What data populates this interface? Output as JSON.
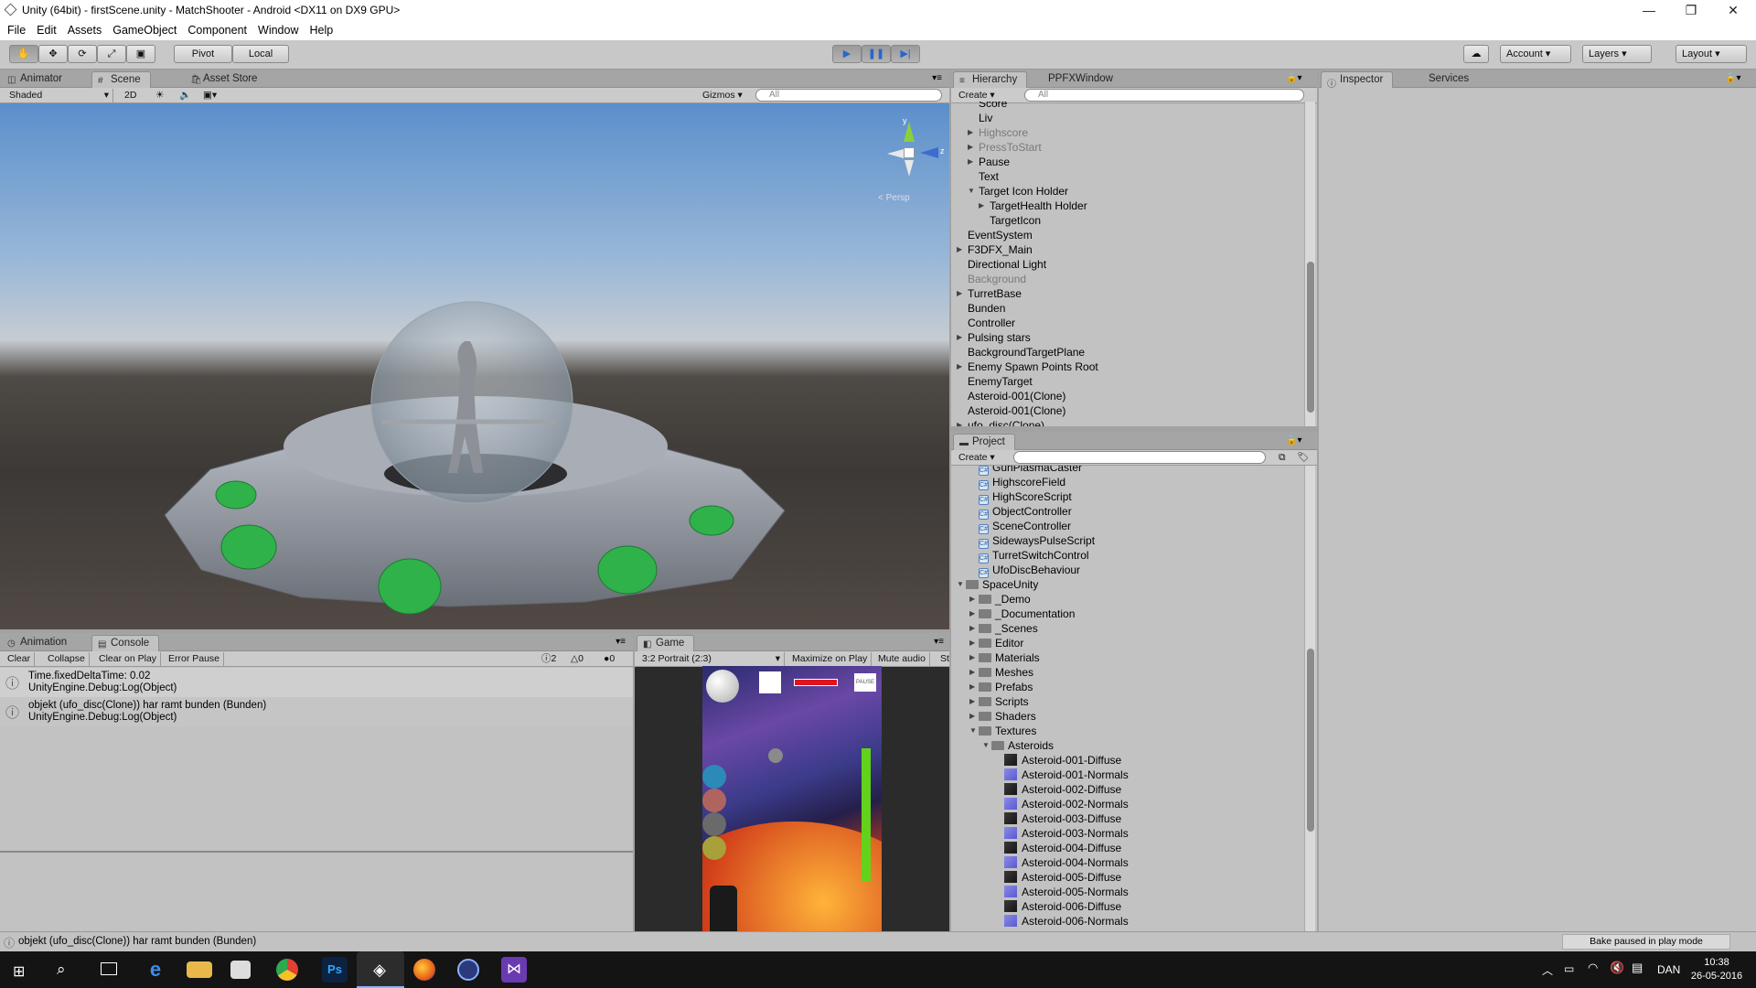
{
  "window": {
    "title": "Unity (64bit) - firstScene.unity - MatchShooter - Android <DX11 on DX9 GPU>",
    "minimize": "—",
    "maximize": "❐",
    "close": "✕"
  },
  "menu": [
    "File",
    "Edit",
    "Assets",
    "GameObject",
    "Component",
    "Window",
    "Help"
  ],
  "toolbar": {
    "pivot": "Pivot",
    "local": "Local",
    "account": "Account",
    "layers": "Layers",
    "layout": "Layout"
  },
  "scene_panel": {
    "tabs": [
      "Animator",
      "Scene",
      "Asset Store"
    ],
    "shading": "Shaded",
    "mode_2d": "2D",
    "gizmos": "Gizmos",
    "search_placeholder": "All",
    "persp": "< Persp",
    "axis_y": "y",
    "axis_z": "z"
  },
  "hierarchy": {
    "tabs": [
      "Hierarchy",
      "PPFXWindow"
    ],
    "create": "Create",
    "search_placeholder": "All",
    "items": [
      {
        "label": "Score",
        "indent": 2,
        "arrow": "",
        "grey": false
      },
      {
        "label": "Liv",
        "indent": 2,
        "arrow": "",
        "grey": false
      },
      {
        "label": "Highscore",
        "indent": 2,
        "arrow": "▶",
        "grey": true
      },
      {
        "label": "PressToStart",
        "indent": 2,
        "arrow": "▶",
        "grey": true
      },
      {
        "label": "Pause",
        "indent": 2,
        "arrow": "▶",
        "grey": false
      },
      {
        "label": "Text",
        "indent": 2,
        "arrow": "",
        "grey": false
      },
      {
        "label": "Target Icon Holder",
        "indent": 2,
        "arrow": "▼",
        "grey": false
      },
      {
        "label": "TargetHealth Holder",
        "indent": 3,
        "arrow": "▶",
        "grey": false
      },
      {
        "label": "TargetIcon",
        "indent": 3,
        "arrow": "",
        "grey": false
      },
      {
        "label": "EventSystem",
        "indent": 1,
        "arrow": "",
        "grey": false
      },
      {
        "label": "F3DFX_Main",
        "indent": 1,
        "arrow": "▶",
        "grey": false
      },
      {
        "label": "Directional Light",
        "indent": 1,
        "arrow": "",
        "grey": false
      },
      {
        "label": "Background",
        "indent": 1,
        "arrow": "",
        "grey": true
      },
      {
        "label": "TurretBase",
        "indent": 1,
        "arrow": "▶",
        "grey": false
      },
      {
        "label": "Bunden",
        "indent": 1,
        "arrow": "",
        "grey": false
      },
      {
        "label": "Controller",
        "indent": 1,
        "arrow": "",
        "grey": false
      },
      {
        "label": "Pulsing stars",
        "indent": 1,
        "arrow": "▶",
        "grey": false
      },
      {
        "label": "BackgroundTargetPlane",
        "indent": 1,
        "arrow": "",
        "grey": false
      },
      {
        "label": "Enemy Spawn Points Root",
        "indent": 1,
        "arrow": "▶",
        "grey": false
      },
      {
        "label": "EnemyTarget",
        "indent": 1,
        "arrow": "",
        "grey": false
      },
      {
        "label": "Asteroid-001(Clone)",
        "indent": 1,
        "arrow": "",
        "grey": false
      },
      {
        "label": "Asteroid-001(Clone)",
        "indent": 1,
        "arrow": "",
        "grey": false
      },
      {
        "label": "ufo_disc(Clone)",
        "indent": 1,
        "arrow": "▶",
        "grey": false
      }
    ]
  },
  "project": {
    "tab": "Project",
    "create": "Create",
    "scripts": [
      "GunPlasmaCaster",
      "HighscoreField",
      "HighScoreScript",
      "ObjectController",
      "SceneController",
      "SidewaysPulseScript",
      "TurretSwitchControl",
      "UfoDiscBehaviour"
    ],
    "folders_root": "SpaceUnity",
    "folders": [
      {
        "label": "_Demo",
        "arrow": "▶"
      },
      {
        "label": "_Documentation",
        "arrow": "▶"
      },
      {
        "label": "_Scenes",
        "arrow": "▶"
      },
      {
        "label": "Editor",
        "arrow": "▶"
      },
      {
        "label": "Materials",
        "arrow": "▶"
      },
      {
        "label": "Meshes",
        "arrow": "▶"
      },
      {
        "label": "Prefabs",
        "arrow": "▶"
      },
      {
        "label": "Scripts",
        "arrow": "▶"
      },
      {
        "label": "Shaders",
        "arrow": "▶"
      },
      {
        "label": "Textures",
        "arrow": "▼"
      }
    ],
    "subfolder": "Asteroids",
    "textures": [
      {
        "label": "Asteroid-001-Diffuse",
        "kind": "diffuse"
      },
      {
        "label": "Asteroid-001-Normals",
        "kind": "normals"
      },
      {
        "label": "Asteroid-002-Diffuse",
        "kind": "diffuse"
      },
      {
        "label": "Asteroid-002-Normals",
        "kind": "normals"
      },
      {
        "label": "Asteroid-003-Diffuse",
        "kind": "diffuse"
      },
      {
        "label": "Asteroid-003-Normals",
        "kind": "normals"
      },
      {
        "label": "Asteroid-004-Diffuse",
        "kind": "diffuse"
      },
      {
        "label": "Asteroid-004-Normals",
        "kind": "normals"
      },
      {
        "label": "Asteroid-005-Diffuse",
        "kind": "diffuse"
      },
      {
        "label": "Asteroid-005-Normals",
        "kind": "normals"
      },
      {
        "label": "Asteroid-006-Diffuse",
        "kind": "diffuse"
      },
      {
        "label": "Asteroid-006-Normals",
        "kind": "normals"
      }
    ]
  },
  "inspector": {
    "tabs": [
      "Inspector",
      "Services"
    ]
  },
  "console": {
    "tabs": [
      "Animation",
      "Console"
    ],
    "buttons": [
      "Clear",
      "Collapse",
      "Clear on Play",
      "Error Pause"
    ],
    "counts": {
      "log": "2",
      "warn": "0",
      "error": "0"
    },
    "entries": [
      {
        "line1": "Time.fixedDeltaTime: 0.02",
        "line2": "UnityEngine.Debug:Log(Object)"
      },
      {
        "line1": "objekt (ufo_disc(Clone)) har ramt bunden (Bunden)",
        "line2": "UnityEngine.Debug:Log(Object)"
      }
    ]
  },
  "game": {
    "tab": "Game",
    "aspect": "3:2 Portrait (2:3)",
    "maximize": "Maximize on Play",
    "mute": "Mute audio",
    "stats": "St",
    "pause_label": "PAUSE"
  },
  "statusbar": {
    "message": "objekt (ufo_disc(Clone)) har ramt bunden (Bunden)",
    "bake": "Bake paused in play mode"
  },
  "taskbar": {
    "lang": "DAN",
    "time": "10:38",
    "date": "26-05-2016"
  },
  "colors": {
    "panel": "#c2c2c2",
    "accent_play": "#3a78d8",
    "taskbar": "#141414"
  }
}
